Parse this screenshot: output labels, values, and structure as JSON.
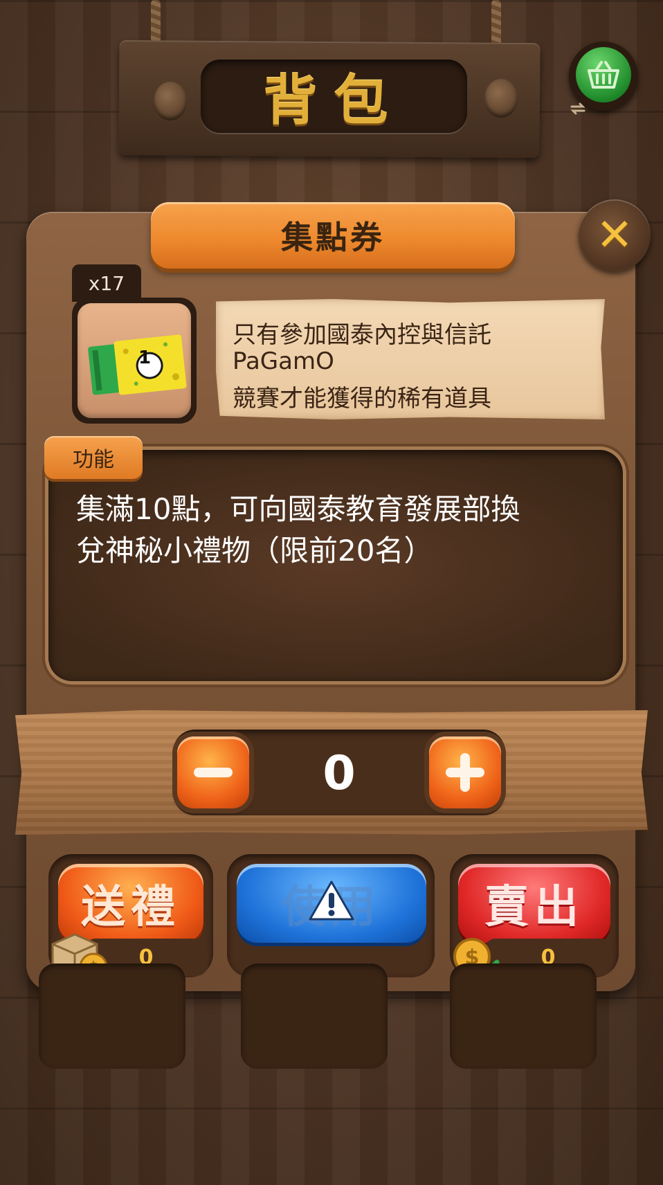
{
  "header": {
    "title": "背包"
  },
  "popup": {
    "title": "集點券",
    "item_count": "x17",
    "description_lines": [
      "只有參加國泰內控與信託",
      "PaGamO",
      "競賽才能獲得的稀有道具"
    ],
    "function_label": "功能",
    "function_lines": [
      "集滿10點，可向國泰教育發展部換",
      "兌神秘小禮物（限前20名）"
    ],
    "ticket_number": "1"
  },
  "quantity": {
    "value": "0",
    "minus": "−",
    "plus": "+"
  },
  "actions": {
    "gift_label": "送禮",
    "use_label": "使用",
    "sell_label": "賣出",
    "gift_count": "0",
    "sell_count": "0"
  },
  "colors": {
    "accent_orange": "#ef8a2e",
    "wood": "#7a5436",
    "use_blue": "#1e72d8",
    "sell_red": "#e02828"
  },
  "icons": [
    "basket-icon",
    "swap-icon",
    "close-icon",
    "minus-icon",
    "plus-icon",
    "warning-icon",
    "gift-box-icon",
    "coin-icon",
    "check-icon"
  ]
}
